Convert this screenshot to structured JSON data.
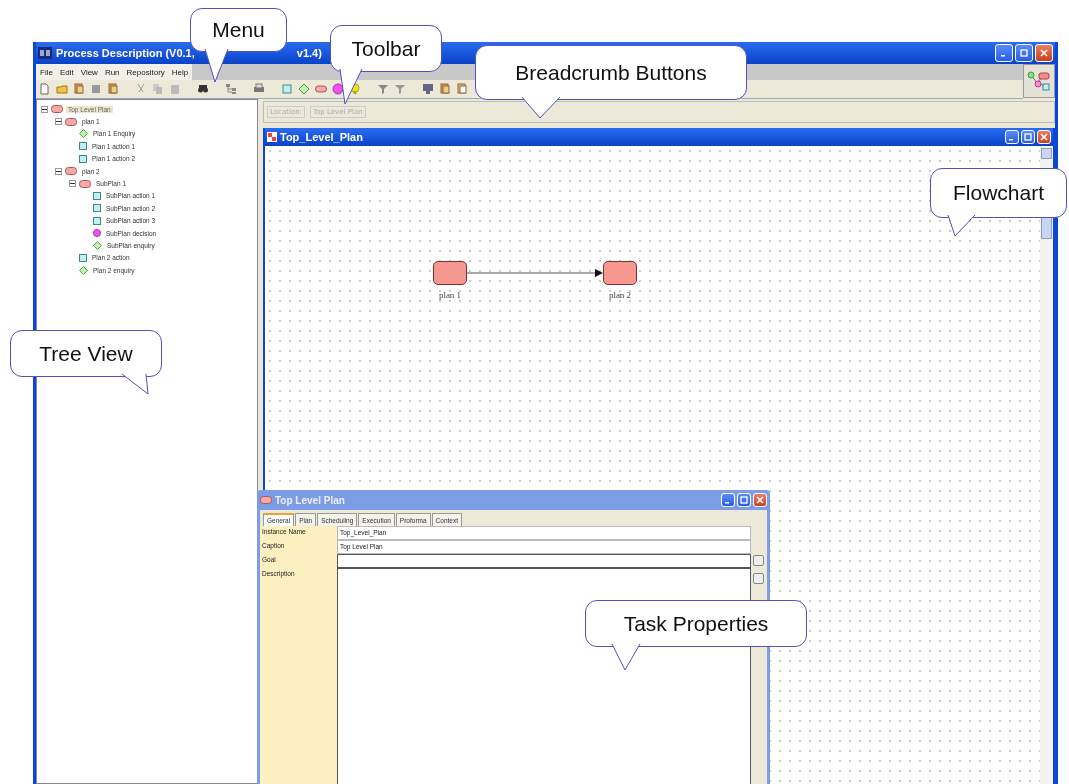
{
  "window": {
    "title_start": "Process Description (V0.1,",
    "title_end": "v1.4)"
  },
  "menu": [
    "File",
    "Edit",
    "View",
    "Run",
    "Repository",
    "Help"
  ],
  "tree": {
    "items": [
      {
        "label": "Top Level Plan",
        "kind": "plan",
        "selected": true,
        "expanded": true,
        "children": [
          {
            "label": "plan 1",
            "kind": "plan",
            "selected": false,
            "expanded": true,
            "children": [
              {
                "label": "Plan 1 Enquiry",
                "kind": "enquiry",
                "selected": false
              },
              {
                "label": "Plan 1 action 1",
                "kind": "action",
                "selected": false
              },
              {
                "label": "Plan 1 action 2",
                "kind": "action",
                "selected": false
              }
            ]
          },
          {
            "label": "plan 2",
            "kind": "plan",
            "selected": false,
            "expanded": true,
            "children": [
              {
                "label": "SubPlan 1",
                "kind": "plan",
                "selected": false,
                "expanded": true,
                "children": [
                  {
                    "label": "SubPlan action 1",
                    "kind": "action",
                    "selected": false
                  },
                  {
                    "label": "SubPlan action 2",
                    "kind": "action",
                    "selected": false
                  },
                  {
                    "label": "SubPlan action 3",
                    "kind": "action",
                    "selected": false
                  },
                  {
                    "label": "SubPlan decision",
                    "kind": "decision",
                    "selected": false
                  },
                  {
                    "label": "SubPlan enquiry",
                    "kind": "enquiry",
                    "selected": false
                  }
                ]
              },
              {
                "label": "Plan 2 action",
                "kind": "action",
                "selected": false
              },
              {
                "label": "Plan 2 enquiry",
                "kind": "enquiry",
                "selected": false
              }
            ]
          }
        ]
      }
    ]
  },
  "breadcrumb": {
    "label": "Location:",
    "buttons": [
      "Top Level Plan"
    ]
  },
  "flowchart": {
    "title": "Top_Level_Plan",
    "nodes": [
      {
        "label": "plan 1"
      },
      {
        "label": "plan 2"
      }
    ]
  },
  "task_properties": {
    "title": "Top Level Plan",
    "tabs": [
      {
        "label": "General",
        "selected": true
      },
      {
        "label": "Plan",
        "selected": false
      },
      {
        "label": "Scheduling",
        "selected": false
      },
      {
        "label": "Execution",
        "selected": false
      },
      {
        "label": "Proforma",
        "selected": false
      },
      {
        "label": "Context",
        "selected": false
      }
    ],
    "fields": [
      {
        "label": "Instance Name",
        "value": "Top_Level_Plan",
        "kind": "line"
      },
      {
        "label": "Caption",
        "value": "Top Level Plan",
        "kind": "line"
      },
      {
        "label": "Goal",
        "kind": "text"
      },
      {
        "label": "Description",
        "kind": "area"
      }
    ]
  },
  "callouts": [
    {
      "text": "Menu"
    },
    {
      "text": "Toolbar"
    },
    {
      "text": "Breadcrumb Buttons"
    },
    {
      "text": "Flowchart"
    },
    {
      "text": "Tree View"
    },
    {
      "text": "Task Properties"
    }
  ]
}
